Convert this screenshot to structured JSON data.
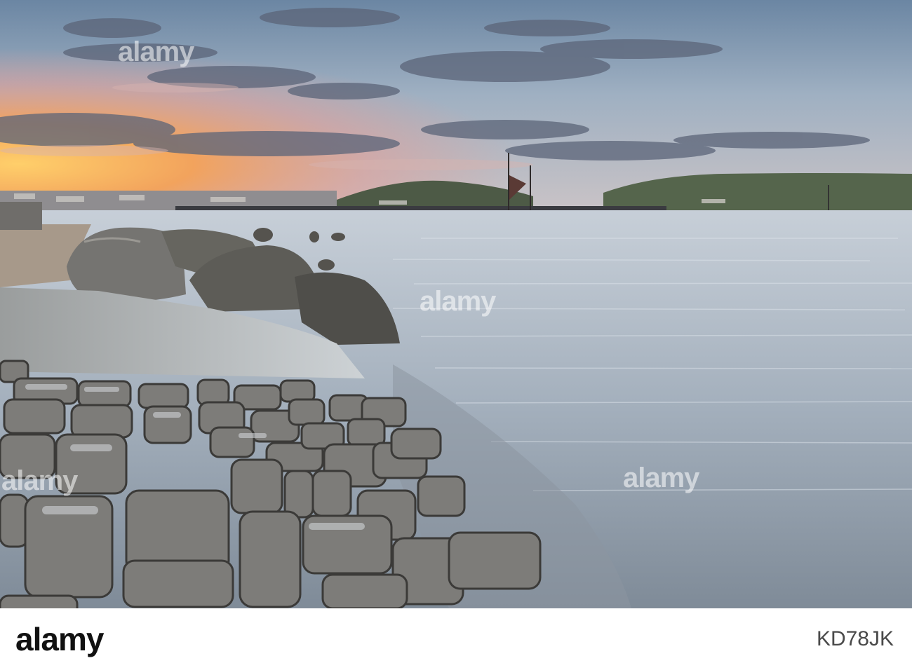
{
  "photo": {
    "description_colors": {
      "sky_top": "#6f8aa6",
      "sunset": "#f4b35c",
      "water": "#b9c5d1",
      "stone": "#6c6c6a"
    }
  },
  "watermark": {
    "brand": "alamy"
  },
  "footer": {
    "logo_text": "alamy",
    "image_id": "KD78JK"
  }
}
